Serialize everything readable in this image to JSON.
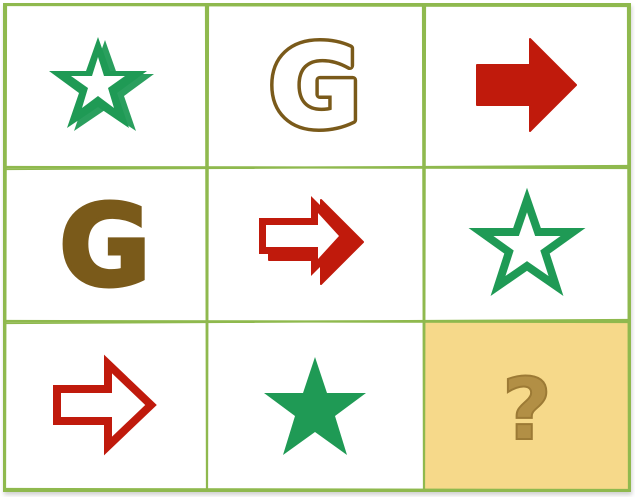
{
  "puzzle": {
    "rows": 3,
    "cols": 3,
    "grid_color": "#8fb94e",
    "answer_cell_color": "#f6d98a",
    "colors": {
      "green": "#1f9a55",
      "olive": "#7a5a1a",
      "red": "#c01a0c",
      "question": "#b28f45"
    },
    "cells": [
      {
        "row": 0,
        "col": 0,
        "shape": "star",
        "style": "outline-thick",
        "color": "green"
      },
      {
        "row": 0,
        "col": 1,
        "shape": "letter-G",
        "text": "G",
        "style": "outline-thick",
        "color": "olive"
      },
      {
        "row": 0,
        "col": 2,
        "shape": "arrow",
        "style": "solid",
        "color": "red"
      },
      {
        "row": 1,
        "col": 0,
        "shape": "letter-G",
        "text": "G",
        "style": "solid",
        "color": "olive"
      },
      {
        "row": 1,
        "col": 1,
        "shape": "arrow",
        "style": "outline-thick",
        "color": "red"
      },
      {
        "row": 1,
        "col": 2,
        "shape": "star",
        "style": "outline-thin",
        "color": "green"
      },
      {
        "row": 2,
        "col": 0,
        "shape": "arrow",
        "style": "outline-thin",
        "color": "red"
      },
      {
        "row": 2,
        "col": 1,
        "shape": "star",
        "style": "solid",
        "color": "green"
      },
      {
        "row": 2,
        "col": 2,
        "shape": "question-mark",
        "text": "?",
        "style": "missing",
        "color": "question"
      }
    ]
  }
}
